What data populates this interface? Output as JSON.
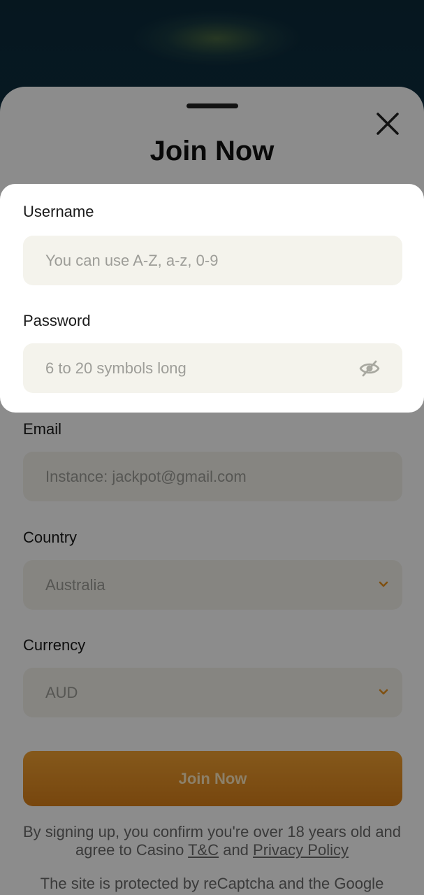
{
  "sheet": {
    "title": "Join Now"
  },
  "fields": {
    "username": {
      "label": "Username",
      "placeholder": "You can use A-Z, a-z, 0-9"
    },
    "password": {
      "label": "Password",
      "placeholder": "6 to 20 symbols long"
    },
    "email": {
      "label": "Email",
      "placeholder": "Instance: jackpot@gmail.com"
    },
    "country": {
      "label": "Country",
      "value": "Australia"
    },
    "currency": {
      "label": "Currency",
      "value": "AUD"
    }
  },
  "submit": {
    "label": "Join Now"
  },
  "legal": {
    "line1_pre": "By signing up, you confirm you're over 18 years old and agree to Casino",
    "tc_link": "T&C",
    "and": "and",
    "privacy_link": "Privacy Policy",
    "recaptcha": "The site is protected by reCaptcha and the Google"
  },
  "icons": {
    "close": "close-icon",
    "eye": "eye-off-icon",
    "chevron": "chevron-down-icon"
  },
  "colors": {
    "accent": "#e8921f",
    "field_bg": "#f4f3ec"
  }
}
